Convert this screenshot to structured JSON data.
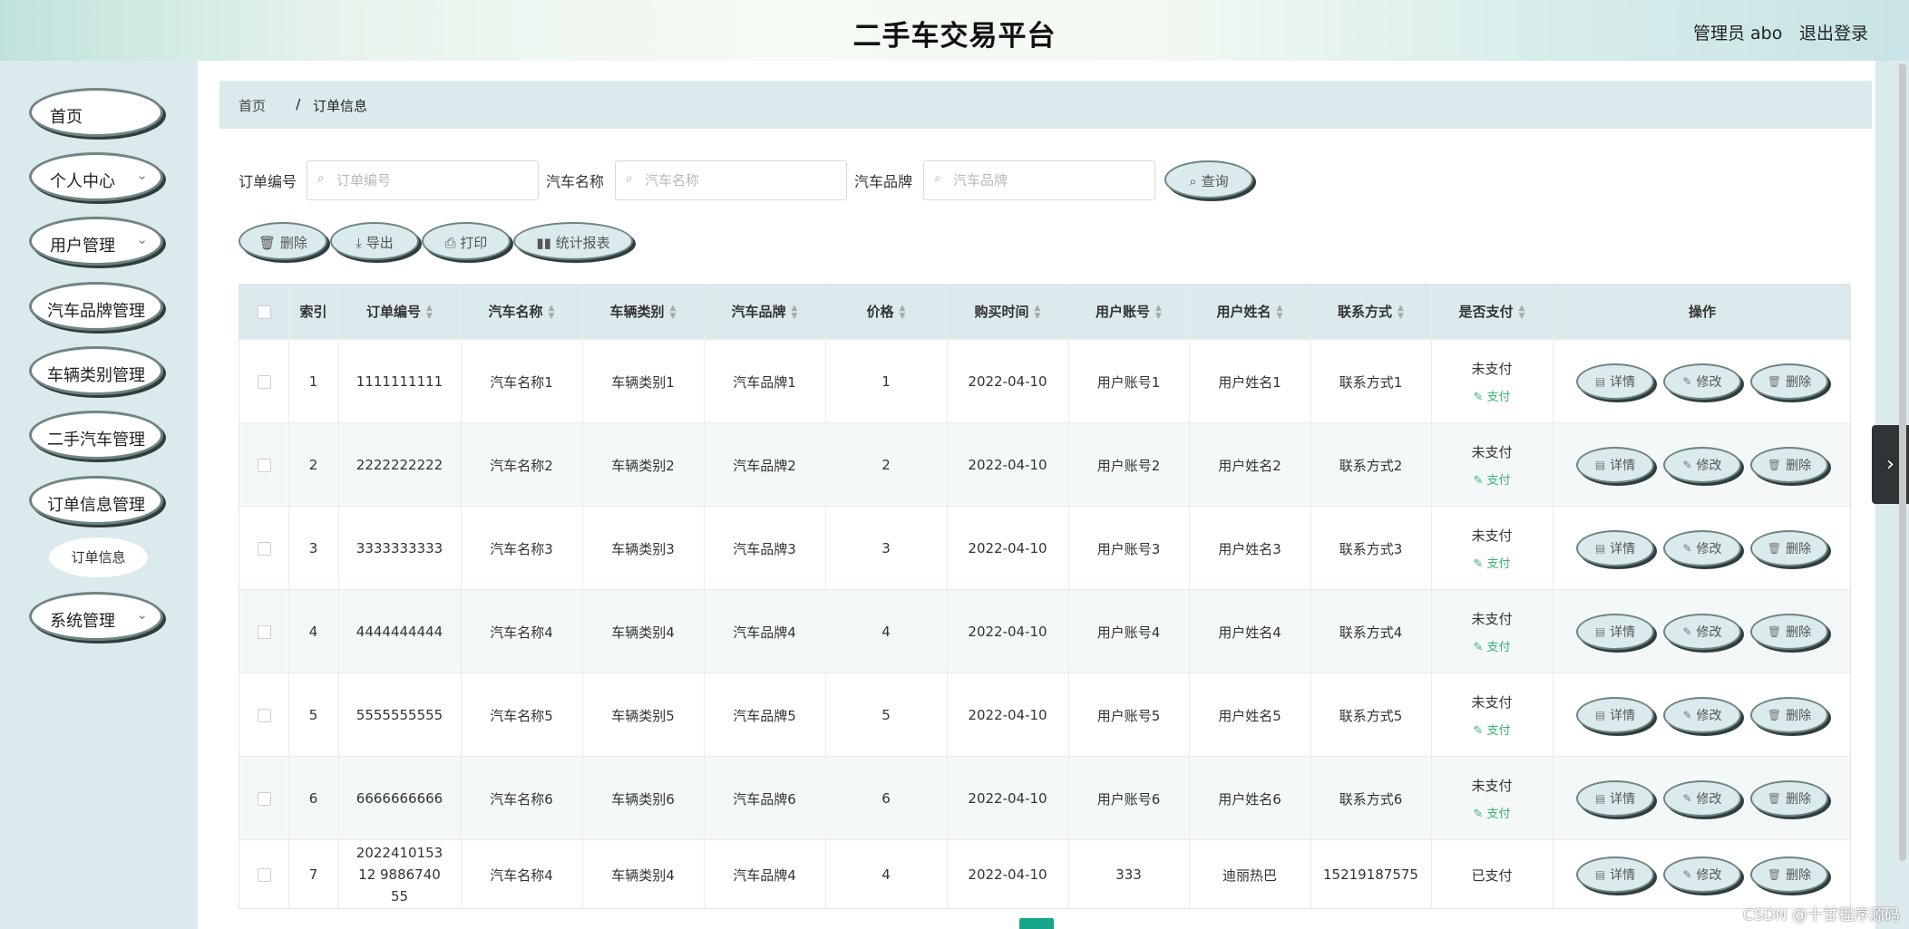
{
  "header": {
    "title": "二手车交易平台",
    "admin": "管理员 abo",
    "logout": "退出登录"
  },
  "sidebar": {
    "items": [
      {
        "label": "首页",
        "chevron": false
      },
      {
        "label": "个人中心",
        "chevron": true
      },
      {
        "label": "用户管理",
        "chevron": true
      },
      {
        "label": "汽车品牌管理",
        "chevron": false
      },
      {
        "label": "车辆类别管理",
        "chevron": false
      },
      {
        "label": "二手汽车管理",
        "chevron": false
      },
      {
        "label": "订单信息管理",
        "chevron": false
      },
      {
        "label": "系统管理",
        "chevron": true
      }
    ],
    "sub_item": "订单信息"
  },
  "breadcrumb": {
    "home": "首页",
    "sep": "/",
    "current": "订单信息"
  },
  "search": {
    "fields": [
      {
        "label": "订单编号",
        "placeholder": "订单编号"
      },
      {
        "label": "汽车名称",
        "placeholder": "汽车名称"
      },
      {
        "label": "汽车品牌",
        "placeholder": "汽车品牌"
      }
    ],
    "query_label": "查询"
  },
  "toolbar": {
    "delete": "删除",
    "export": "导出",
    "print": "打印",
    "report": "统计报表"
  },
  "table": {
    "columns": [
      "索引",
      "订单编号",
      "汽车名称",
      "车辆类别",
      "汽车品牌",
      "价格",
      "购买时间",
      "用户账号",
      "用户姓名",
      "联系方式",
      "是否支付",
      "操作"
    ],
    "rows": [
      {
        "idx": "1",
        "order": "1111111111",
        "name": "汽车名称1",
        "category": "车辆类别1",
        "brand": "汽车品牌1",
        "price": "1",
        "date": "2022-04-10",
        "account": "用户账号1",
        "username": "用户姓名1",
        "contact": "联系方式1",
        "paid": "未支付",
        "pay_link": "支付"
      },
      {
        "idx": "2",
        "order": "2222222222",
        "name": "汽车名称2",
        "category": "车辆类别2",
        "brand": "汽车品牌2",
        "price": "2",
        "date": "2022-04-10",
        "account": "用户账号2",
        "username": "用户姓名2",
        "contact": "联系方式2",
        "paid": "未支付",
        "pay_link": "支付"
      },
      {
        "idx": "3",
        "order": "3333333333",
        "name": "汽车名称3",
        "category": "车辆类别3",
        "brand": "汽车品牌3",
        "price": "3",
        "date": "2022-04-10",
        "account": "用户账号3",
        "username": "用户姓名3",
        "contact": "联系方式3",
        "paid": "未支付",
        "pay_link": "支付"
      },
      {
        "idx": "4",
        "order": "4444444444",
        "name": "汽车名称4",
        "category": "车辆类别4",
        "brand": "汽车品牌4",
        "price": "4",
        "date": "2022-04-10",
        "account": "用户账号4",
        "username": "用户姓名4",
        "contact": "联系方式4",
        "paid": "未支付",
        "pay_link": "支付"
      },
      {
        "idx": "5",
        "order": "5555555555",
        "name": "汽车名称5",
        "category": "车辆类别5",
        "brand": "汽车品牌5",
        "price": "5",
        "date": "2022-04-10",
        "account": "用户账号5",
        "username": "用户姓名5",
        "contact": "联系方式5",
        "paid": "未支付",
        "pay_link": "支付"
      },
      {
        "idx": "6",
        "order": "6666666666",
        "name": "汽车名称6",
        "category": "车辆类别6",
        "brand": "汽车品牌6",
        "price": "6",
        "date": "2022-04-10",
        "account": "用户账号6",
        "username": "用户姓名6",
        "contact": "联系方式6",
        "paid": "未支付",
        "pay_link": "支付"
      },
      {
        "idx": "7",
        "order": "202241015312 988674055",
        "name": "汽车名称4",
        "category": "车辆类别4",
        "brand": "汽车品牌4",
        "price": "4",
        "date": "2022-04-10",
        "account": "333",
        "username": "迪丽热巴",
        "contact": "15219187575",
        "paid": "已支付",
        "pay_link": ""
      }
    ],
    "actions": {
      "detail": "详情",
      "edit": "修改",
      "delete": "删除"
    }
  },
  "watermark": "CSDN @十甘程序源码",
  "icons": [
    "search-icon",
    "trash-icon",
    "download-icon",
    "printer-icon",
    "bar-chart-icon",
    "chevron-down-icon",
    "chevron-right-icon",
    "edit-icon",
    "document-icon"
  ],
  "colors": {
    "accent": "#dbeaec",
    "pay_green": "#3cb371",
    "pager_active": "#17a589"
  }
}
